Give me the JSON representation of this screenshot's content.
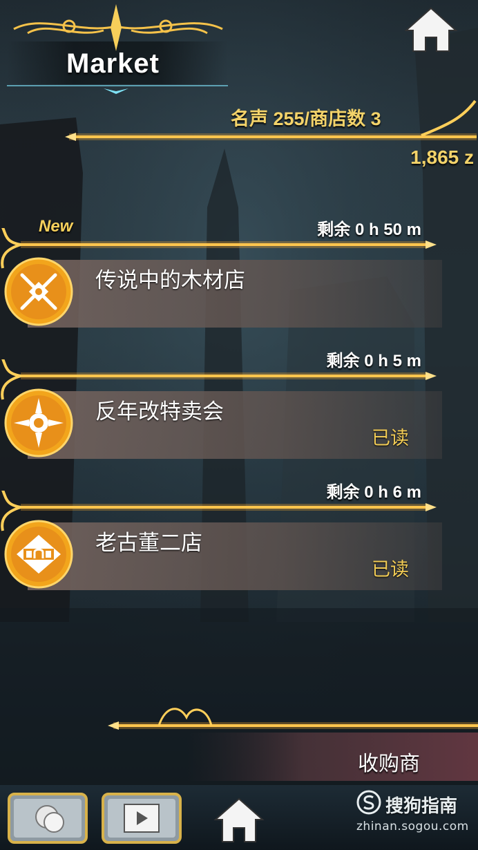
{
  "header": {
    "title": "Market",
    "reputation_label": "名声",
    "reputation_value": "255",
    "shop_count_label": "/商店数",
    "shop_count_value": "3",
    "money": "1,865 z"
  },
  "shops": [
    {
      "timer": "剩余 0 h 50 m",
      "new_tag": "New",
      "name": "传说中的木材店",
      "status": "",
      "emblem": "crossed-arrows-emblem-icon"
    },
    {
      "timer": "剩余 0 h 5 m",
      "new_tag": "",
      "name": "反年改特卖会",
      "status": "已读",
      "emblem": "sun-gear-emblem-icon"
    },
    {
      "timer": "剩余 0 h 6 m",
      "new_tag": "",
      "name": "老古董二店",
      "status": "已读",
      "emblem": "diamond-plaque-emblem-icon"
    }
  ],
  "buyer": {
    "label": "收购商"
  },
  "bottom_nav": {
    "items": [
      "coin-button-icon",
      "video-button-icon",
      "home-icon"
    ]
  },
  "watermark": {
    "brand": "搜狗指南",
    "url": "zhinan.sogou.com"
  },
  "colors": {
    "gold": "#f3d36a",
    "accent_glow": "#ffb030",
    "read_status": "#f2cc55"
  }
}
